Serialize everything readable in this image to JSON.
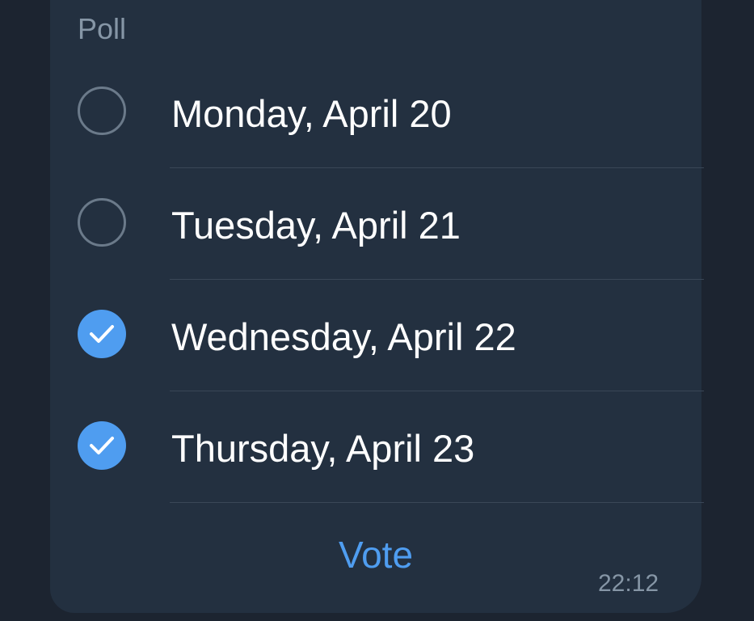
{
  "poll": {
    "type_label": "Poll",
    "options": [
      {
        "label": "Monday, April 20",
        "checked": false
      },
      {
        "label": "Tuesday, April 21",
        "checked": false
      },
      {
        "label": "Wednesday, April 22",
        "checked": true
      },
      {
        "label": "Thursday, April 23",
        "checked": true
      }
    ],
    "vote_label": "Vote",
    "timestamp": "22:12"
  },
  "colors": {
    "background": "#1c2430",
    "bubble": "#233040",
    "accent": "#4f9df0",
    "muted_text": "#8696a6",
    "divider": "#3a4757"
  }
}
